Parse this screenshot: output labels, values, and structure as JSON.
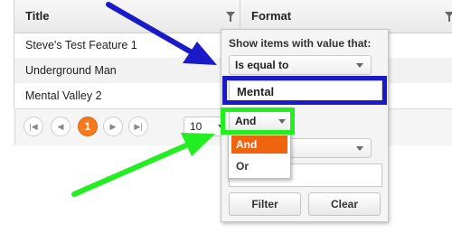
{
  "grid": {
    "columns": [
      {
        "label": "Title"
      },
      {
        "label": "Format"
      }
    ],
    "rows": [
      {
        "title": "Steve's Test Feature 1"
      },
      {
        "title": "Underground Man"
      },
      {
        "title": "Mental Valley 2"
      }
    ]
  },
  "pager": {
    "first_icon": "first-page-icon",
    "prev_icon": "previous-page-icon",
    "current_page": "1",
    "next_icon": "next-page-icon",
    "last_icon": "last-page-icon",
    "page_size": "10",
    "accent": "#f47a20"
  },
  "filter": {
    "heading": "Show items with value that:",
    "operator1": "Is equal to",
    "value1": "Mental",
    "logic": "And",
    "logic_options": [
      "And",
      "Or"
    ],
    "operator2": "",
    "value2": "",
    "filter_button": "Filter",
    "clear_button": "Clear"
  },
  "annotations": {
    "blue": "#1a1ac8",
    "green": "#22ee22"
  }
}
